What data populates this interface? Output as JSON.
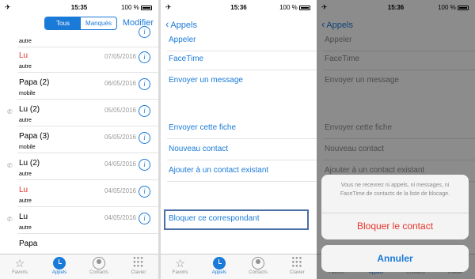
{
  "panel1": {
    "status": {
      "plane": "✈",
      "time": "15:35",
      "battery": "100 %"
    },
    "segment": {
      "left": "Tous",
      "right": "Manqués"
    },
    "edit": "Modifier",
    "rows": [
      {
        "name": "",
        "sub": "autre",
        "date": "",
        "missed": false,
        "phone": false
      },
      {
        "name": "Lu",
        "sub": "autre",
        "date": "07/05/2016",
        "missed": true,
        "phone": false
      },
      {
        "name": "Papa  (2)",
        "sub": "mobile",
        "date": "06/05/2016",
        "missed": false,
        "phone": false
      },
      {
        "name": "Lu  (2)",
        "sub": "autre",
        "date": "05/05/2016",
        "missed": false,
        "phone": true
      },
      {
        "name": "Papa  (3)",
        "sub": "mobile",
        "date": "05/05/2016",
        "missed": false,
        "phone": false
      },
      {
        "name": "Lu  (2)",
        "sub": "autre",
        "date": "04/05/2016",
        "missed": false,
        "phone": true
      },
      {
        "name": "Lu",
        "sub": "autre",
        "date": "04/05/2016",
        "missed": true,
        "phone": false
      },
      {
        "name": "Lu",
        "sub": "autre",
        "date": "04/05/2016",
        "missed": false,
        "phone": true
      },
      {
        "name": "Papa",
        "sub": "",
        "date": "",
        "missed": false,
        "phone": false
      }
    ],
    "tabs": [
      "Favoris",
      "Appels",
      "Contacts",
      "Clavier"
    ]
  },
  "panel2": {
    "status": {
      "plane": "✈",
      "time": "15:36",
      "battery": "100 %"
    },
    "back": "Appels",
    "actions": [
      "Appeler",
      "FaceTime",
      "Envoyer un message",
      "Envoyer cette fiche",
      "Nouveau contact",
      "Ajouter à un contact existant",
      "Bloquer ce correspondant"
    ],
    "tabs": [
      "Favoris",
      "Appels",
      "Contacts",
      "Clavier"
    ]
  },
  "panel3": {
    "status": {
      "plane": "✈",
      "time": "15:36",
      "battery": "100 %"
    },
    "back": "Appels",
    "actions": [
      "Appeler",
      "FaceTime",
      "Envoyer un message",
      "Envoyer cette fiche",
      "Nouveau contact",
      "Ajouter à un contact existant"
    ],
    "sheet_message": "Vous ne recevrez ni appels, ni messages, ni FaceTime de contacts de la liste de blocage.",
    "sheet_action": "Bloquer le contact",
    "cancel": "Annuler",
    "tabs": [
      "Favoris",
      "Appels",
      "Contacts",
      "Clavier"
    ]
  },
  "colors": {
    "accent": "#1a7ad8",
    "missed": "#e8332b"
  },
  "icons": {
    "info": "i",
    "star": "☆",
    "keypad": "⠿",
    "back": "‹",
    "phone": "✆"
  }
}
